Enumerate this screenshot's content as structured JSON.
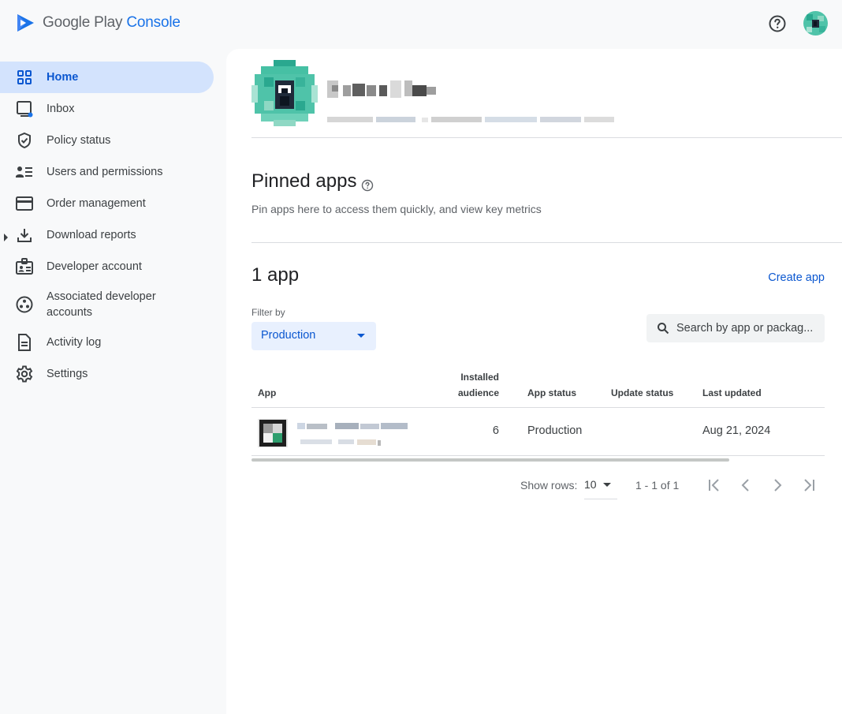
{
  "brand": {
    "name_part1": "Google Play",
    "name_part2": "Console",
    "accent": "#1a73e8"
  },
  "topbar": {
    "help_icon": "help-circle-icon",
    "avatar": "user-avatar"
  },
  "sidebar": {
    "items": [
      {
        "label": "Home",
        "icon": "grid-icon",
        "active": true
      },
      {
        "label": "Inbox",
        "icon": "inbox-icon"
      },
      {
        "label": "Policy status",
        "icon": "shield-check-icon"
      },
      {
        "label": "Users and permissions",
        "icon": "users-list-icon"
      },
      {
        "label": "Order management",
        "icon": "credit-card-icon"
      },
      {
        "label": "Download reports",
        "icon": "download-icon",
        "expandable": true
      },
      {
        "label": "Developer account",
        "icon": "id-badge-icon"
      },
      {
        "label": "Associated developer accounts",
        "icon": "linked-accounts-icon"
      },
      {
        "label": "Activity log",
        "icon": "document-icon"
      },
      {
        "label": "Settings",
        "icon": "gear-icon"
      }
    ]
  },
  "pinned": {
    "title": "Pinned apps",
    "subtitle": "Pin apps here to access them quickly, and view key metrics"
  },
  "apps": {
    "count_label": "1 app",
    "create_label": "Create app",
    "filter_label": "Filter by",
    "filter_value": "Production",
    "search_placeholder": "Search by app or packag..."
  },
  "table": {
    "headers": {
      "app": "App",
      "installed": [
        "Installed",
        "audience"
      ],
      "app_status": "App status",
      "update_status": "Update status",
      "last_updated": "Last updated"
    },
    "rows": [
      {
        "installed": "6",
        "app_status": "Production",
        "update_status": "",
        "last_updated": "Aug 21, 2024"
      }
    ]
  },
  "pagination": {
    "rows_label": "Show rows:",
    "rows_value": "10",
    "range": "1 - 1 of 1"
  }
}
